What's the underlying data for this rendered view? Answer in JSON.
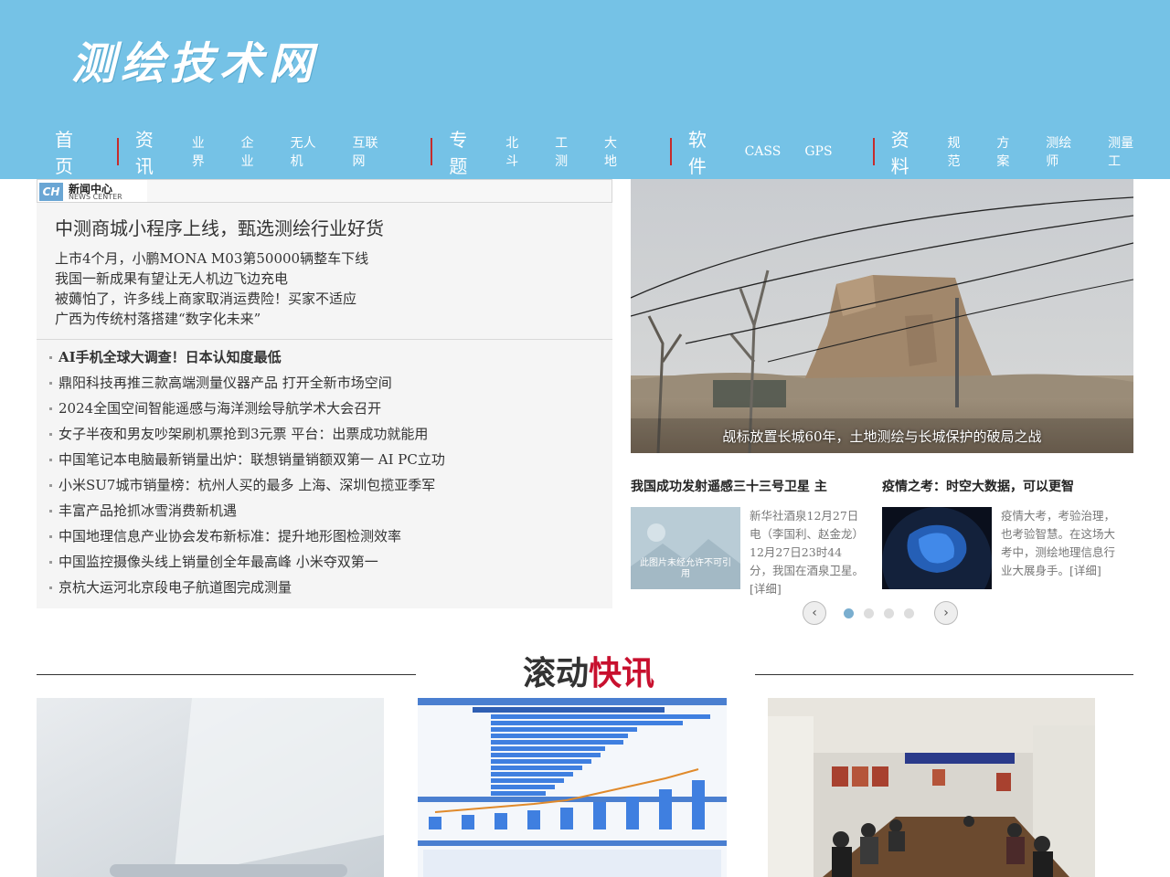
{
  "header": {
    "logo": "测绘技术网",
    "nav": [
      {
        "main": "首页",
        "subs": []
      },
      {
        "main": "资讯",
        "subs": [
          "业界",
          "企业",
          "无人机",
          "互联网"
        ]
      },
      {
        "main": "专题",
        "subs": [
          "北斗",
          "工测",
          "大地"
        ]
      },
      {
        "main": "软件",
        "subs": [
          "CASS",
          "GPS"
        ]
      },
      {
        "main": "资料",
        "subs": [
          "规范",
          "方案",
          "测绘师",
          "测量工"
        ]
      }
    ]
  },
  "news_center": {
    "badge_logo": "CH",
    "badge_title": "新闻中心",
    "badge_sub": "NEWS CENTER",
    "headline": "中测商城小程序上线，甄选测绘行业好货",
    "sub_links": [
      "上市4个月，小鹏MONA M03第50000辆整车下线",
      "我国一新成果有望让无人机边飞边充电",
      "被薅怕了，许多线上商家取消运费险！买家不适应",
      "广西为传统村落搭建“数字化未来”"
    ],
    "list": [
      "AI手机全球大调查！日本认知度最低",
      "鼎阳科技再推三款高端测量仪器产品 打开全新市场空间",
      "2024全国空间智能遥感与海洋测绘导航学术大会召开",
      "女子半夜和男友吵架刷机票抢到3元票 平台：出票成功就能用",
      "中国笔记本电脑最新销量出炉：联想销量销额双第一 AI PC立功",
      "小米SU7城市销量榜：杭州人买的最多 上海、深圳包揽亚季军",
      "丰富产品抢抓冰雪消费新机遇",
      "中国地理信息产业协会发布新标准：提升地形图检测效率",
      "中国监控摄像头线上销量创全年最高峰 小米夺双第一",
      "京杭大运河北京段电子航道图完成测量"
    ]
  },
  "feature": {
    "caption": "觇标放置长城60年，土地测绘与长城保护的破局之战"
  },
  "cards": [
    {
      "title": "我国成功发射遥感三十三号卫星 主",
      "thumb_text": "此图片未经允许不可引用",
      "text": "新华社酒泉12月27日电（李国利、赵金龙）12月27日23时44分，我国在酒泉卫星。[详细]"
    },
    {
      "title": "疫情之考：时空大数据，可以更智",
      "text": "疫情大考，考验治理，也考验智慧。在这场大考中，测绘地理信息行业大展身手。[详细]"
    }
  ],
  "pager": {
    "prev": "‹",
    "next": "›",
    "active_index": 0,
    "count": 4
  },
  "scroll_news": {
    "title_part1": "滚动",
    "title_part2": "快讯"
  },
  "colors": {
    "header_bg": "#75c2e6",
    "nav_separator": "#c62b2b",
    "accent_red": "#c8102e"
  }
}
